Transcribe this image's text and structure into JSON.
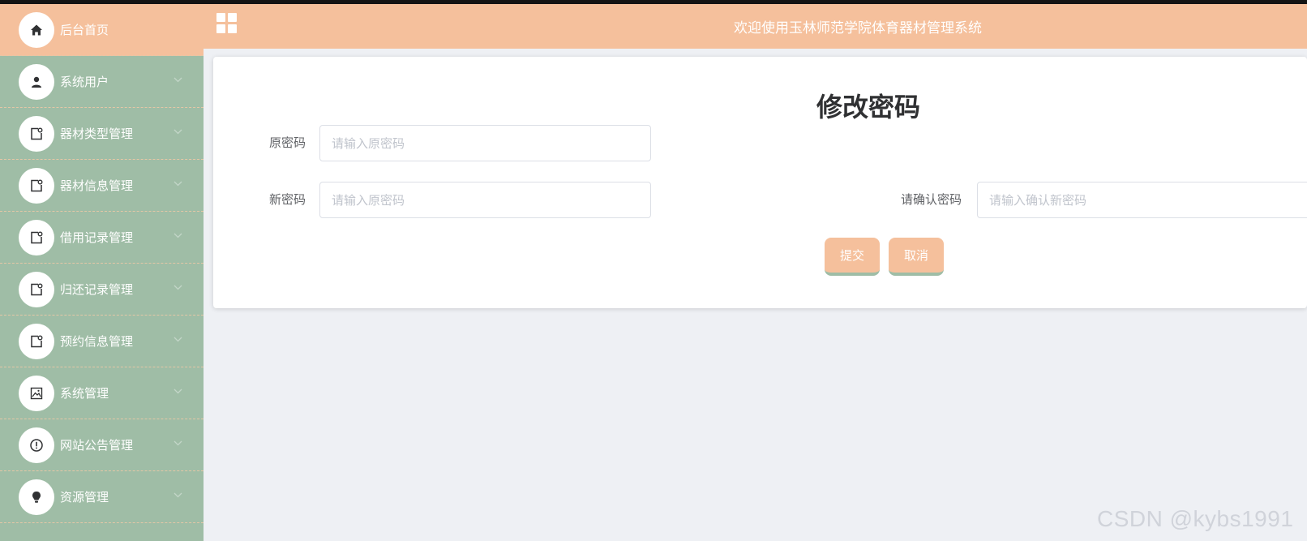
{
  "header": {
    "title": "欢迎使用玉林师范学院体育器材管理系统",
    "menu_icon": "grid-icon"
  },
  "sidebar": {
    "items": [
      {
        "label": "后台首页",
        "icon": "home-icon",
        "active": true,
        "has_submenu": false
      },
      {
        "label": "系统用户",
        "icon": "user-icon",
        "active": false,
        "has_submenu": true
      },
      {
        "label": "器材类型管理",
        "icon": "document-icon",
        "active": false,
        "has_submenu": true
      },
      {
        "label": "器材信息管理",
        "icon": "document-icon",
        "active": false,
        "has_submenu": true
      },
      {
        "label": "借用记录管理",
        "icon": "document-icon",
        "active": false,
        "has_submenu": true
      },
      {
        "label": "归还记录管理",
        "icon": "document-icon",
        "active": false,
        "has_submenu": true
      },
      {
        "label": "预约信息管理",
        "icon": "document-icon",
        "active": false,
        "has_submenu": true
      },
      {
        "label": "系统管理",
        "icon": "picture-icon",
        "active": false,
        "has_submenu": true
      },
      {
        "label": "网站公告管理",
        "icon": "warning-icon",
        "active": false,
        "has_submenu": true
      },
      {
        "label": "资源管理",
        "icon": "bulb-icon",
        "active": false,
        "has_submenu": true
      }
    ]
  },
  "form": {
    "title": "修改密码",
    "old_password": {
      "label": "原密码",
      "placeholder": "请输入原密码",
      "value": ""
    },
    "new_password": {
      "label": "新密码",
      "placeholder": "请输入原密码",
      "value": ""
    },
    "confirm_password": {
      "label": "请确认密码",
      "placeholder": "请输入确认新密码",
      "value": ""
    },
    "submit_label": "提交",
    "cancel_label": "取消"
  },
  "watermark": "CSDN @kybs1991",
  "colors": {
    "accent": "#f5c09c",
    "sidebar": "#9fbda6",
    "background": "#eef0f4"
  }
}
